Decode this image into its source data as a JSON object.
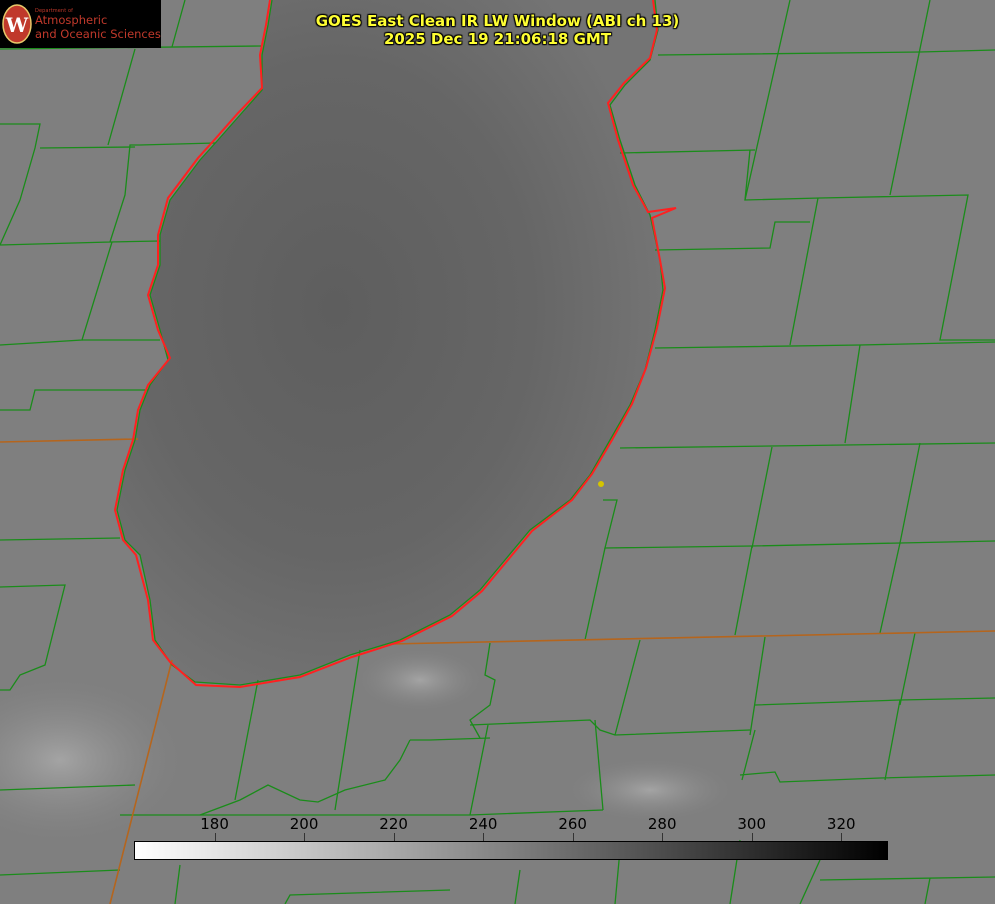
{
  "header": {
    "title_line1": "GOES East Clean IR LW Window (ABI ch 13)",
    "title_line2": "2025 Dec 19 21:06:18 GMT",
    "title_color": "#ffff33"
  },
  "logo": {
    "small_text": "Department of",
    "line1": "Atmospheric",
    "line2": "and Oceanic Sciences",
    "seal_letter": "W",
    "text_color": "#c0392b"
  },
  "colorbar": {
    "min": 162,
    "max": 330,
    "ticks": [
      {
        "value": 180,
        "label": "180"
      },
      {
        "value": 200,
        "label": "200"
      },
      {
        "value": 220,
        "label": "220"
      },
      {
        "value": 240,
        "label": "240"
      },
      {
        "value": 260,
        "label": "260"
      },
      {
        "value": 280,
        "label": "280"
      },
      {
        "value": 300,
        "label": "300"
      },
      {
        "value": 320,
        "label": "320"
      }
    ],
    "gradient_from": "#ffffff",
    "gradient_to": "#000000"
  },
  "map": {
    "background_color": "#7e7e7e",
    "lake_color": "#6a6a6a",
    "county_line_color": "#1a8c1a",
    "state_line_color": "#b5651d",
    "coastline_color": "#ff2020",
    "station_marker_color": "#d4c400"
  }
}
